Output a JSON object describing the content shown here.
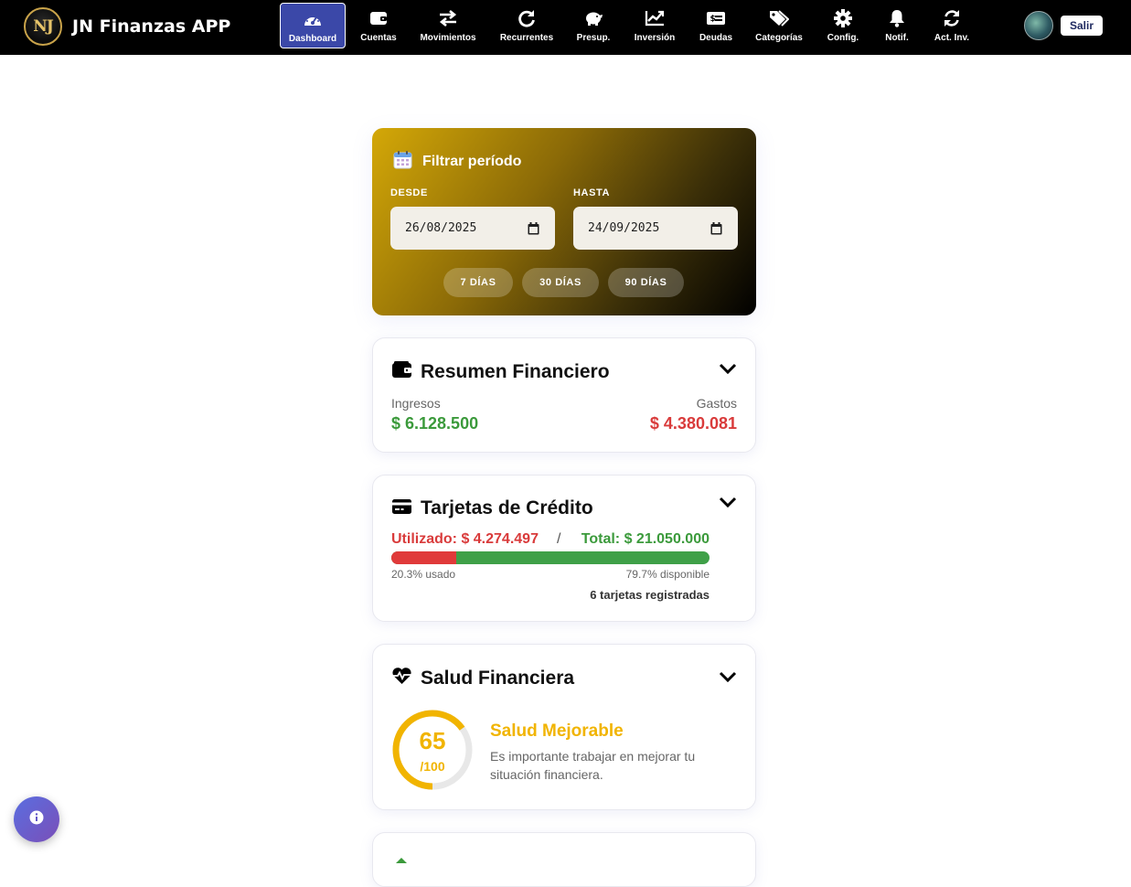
{
  "app": {
    "logo_text": "NJ",
    "name": "JN Finanzas APP"
  },
  "nav": {
    "items": [
      {
        "label": "Dashboard",
        "icon": "gauge-icon",
        "active": true
      },
      {
        "label": "Cuentas",
        "icon": "wallet-icon"
      },
      {
        "label": "Movimientos",
        "icon": "exchange-icon"
      },
      {
        "label": "Recurrentes",
        "icon": "redo-icon"
      },
      {
        "label": "Presup.",
        "icon": "piggy-bank-icon"
      },
      {
        "label": "Inversión",
        "icon": "chart-line-icon"
      },
      {
        "label": "Deudas",
        "icon": "money-check-icon"
      },
      {
        "label": "Categorías",
        "icon": "tags-icon"
      },
      {
        "label": "Config.",
        "icon": "gear-icon"
      },
      {
        "label": "Notif.",
        "icon": "bell-icon"
      },
      {
        "label": "Act. Inv.",
        "icon": "sync-icon"
      }
    ],
    "logout_label": "Salir"
  },
  "filter": {
    "title": "Filtrar período",
    "from_label": "DESDE",
    "from_value": "26/08/2025",
    "to_label": "HASTA",
    "to_value": "24/09/2025",
    "quick": [
      "7 DÍAS",
      "30 DÍAS",
      "90 DÍAS"
    ]
  },
  "summary": {
    "title": "Resumen Financiero",
    "income_label": "Ingresos",
    "income_value": "$ 6.128.500",
    "expense_label": "Gastos",
    "expense_value": "$ 4.380.081"
  },
  "cards": {
    "title": "Tarjetas de Crédito",
    "used_text": "Utilizado: $ 4.274.497",
    "separator": "/",
    "total_text": "Total: $ 21.050.000",
    "used_pct": 20.3,
    "used_pct_text": "20.3% usado",
    "available_pct_text": "79.7% disponible",
    "count_text": "6 tarjetas registradas"
  },
  "health": {
    "title": "Salud Financiera",
    "score": "65",
    "score_max": "/100",
    "score_value": 65,
    "status": "Salud Mejorable",
    "description_line1": "Es importante trabajar en mejorar tu",
    "description_line2": "situación financiera."
  },
  "colors": {
    "navbar": "#000000",
    "active_nav": "#3b48a8",
    "income": "#3b9a3b",
    "expense": "#d93b3b",
    "health": "#f1b400"
  }
}
